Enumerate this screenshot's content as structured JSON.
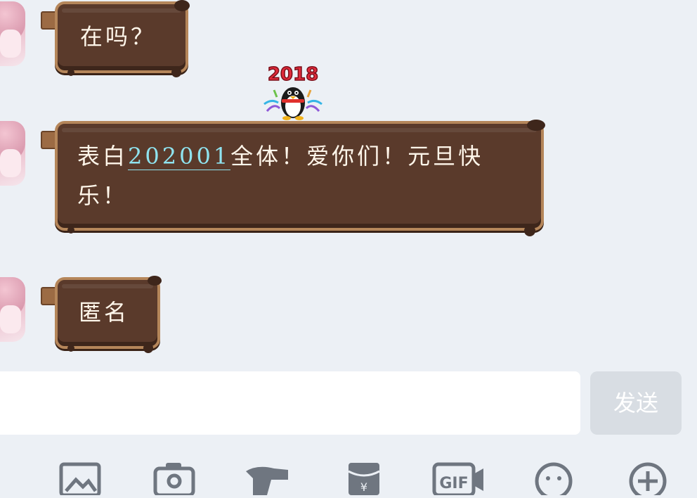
{
  "messages": [
    {
      "text": "在吗？"
    },
    {
      "text_before": "表白",
      "link": "202001",
      "text_after": "全体！爱你们！元旦快",
      "text_line2": "乐！"
    },
    {
      "text": "匿名"
    }
  ],
  "sticker": {
    "label": "2018",
    "icon": "penguin-2018-sticker"
  },
  "composer": {
    "value": "",
    "placeholder": ""
  },
  "send_label": "发送",
  "toolbar": [
    "voice-icon",
    "image-icon",
    "camera-icon",
    "hongbao-icon",
    "red-packet-icon",
    "gif-icon",
    "emoji-icon",
    "plus-icon"
  ],
  "colors": {
    "bubble": "#5a3a2b",
    "bubble_border": "#b5865a",
    "link": "#8fe3ef",
    "background": "#ecf0f5"
  }
}
